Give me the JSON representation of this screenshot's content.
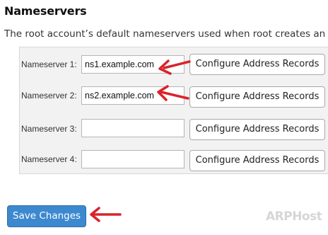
{
  "section": {
    "title": "Nameservers",
    "description": "The root account’s default nameservers used when root creates an acc"
  },
  "nameservers": [
    {
      "label": "Nameserver 1:",
      "value": "ns1.example.com",
      "button_label": "Configure Address Records"
    },
    {
      "label": "Nameserver 2:",
      "value": "ns2.example.com",
      "button_label": "Configure Address Records"
    },
    {
      "label": "Nameserver 3:",
      "value": "",
      "button_label": "Configure Address Records"
    },
    {
      "label": "Nameserver 4:",
      "value": "",
      "button_label": "Configure Address Records"
    }
  ],
  "actions": {
    "save_label": "Save Changes"
  },
  "annotations": {
    "arrow_color": "#d9232a"
  },
  "watermark": {
    "text": "ARPHost"
  },
  "colors": {
    "primary_button": "#3d89d0",
    "panel_background": "#f2f2f2"
  }
}
